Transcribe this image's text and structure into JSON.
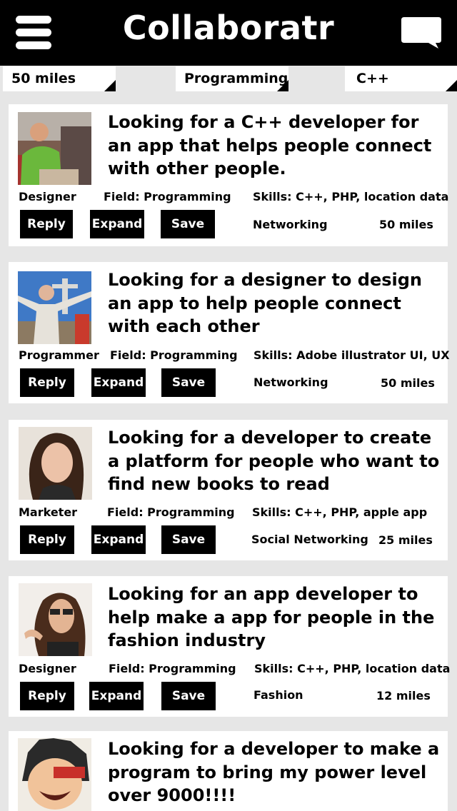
{
  "header": {
    "title": "Collaboratr",
    "menu_icon": "hamburger-menu-icon",
    "chat_icon": "chat-bubble-icon"
  },
  "filters": [
    {
      "label": "50 miles"
    },
    {
      "label": "Programming"
    },
    {
      "label": "C++"
    }
  ],
  "buttons": {
    "reply": "Reply",
    "expand": "Expand",
    "save": "Save"
  },
  "posts": [
    {
      "title": "Looking for a C++ developer for an app that helps people connect with other people.",
      "role": "Designer",
      "field": "Field: Programming",
      "skills": "Skills: C++, PHP, location data",
      "category": "Networking",
      "distance": "50 miles"
    },
    {
      "title": "Looking for a designer to design an app to help people connect with each other",
      "role": "Programmer",
      "field": "Field: Programming",
      "skills": "Skills: Adobe illustrator UI, UX",
      "category": "Networking",
      "distance": "50 miles"
    },
    {
      "title": "Looking for a developer to create a platform for people who want to find new books to read",
      "role": "Marketer",
      "field": "Field: Programming",
      "skills": "Skills: C++, PHP, apple app",
      "category": "Social Networking",
      "distance": "25 miles"
    },
    {
      "title": "Looking for an app developer to help make a app for people in the fashion industry",
      "role": "Designer",
      "field": "Field: Programming",
      "skills": "Skills: C++, PHP, location data",
      "category": "Fashion",
      "distance": "12 miles"
    },
    {
      "title": "Looking for a developer to make a program to bring my power level over 9000!!!!"
    }
  ]
}
